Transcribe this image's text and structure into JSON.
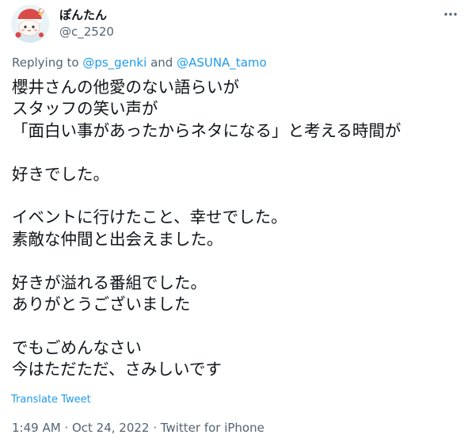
{
  "author": {
    "display_name": "ぽんたん",
    "handle": "@c_2520",
    "avatar": "avatar-illustration"
  },
  "icons": {
    "more": "more-horizontal-icon"
  },
  "reply": {
    "prefix": "Replying to ",
    "mention_1": "@ps_genki",
    "joiner": " and ",
    "mention_2": "@ASUNA_tamo"
  },
  "tweet": {
    "lines": [
      "櫻井さんの他愛のない語らいが",
      "スタッフの笑い声が",
      "「面白い事があったからネタになる」と考える時間が",
      "",
      "好きでした。",
      "",
      "イベントに行けたこと、幸せでした。",
      "素敵な仲間と出会えました。",
      "",
      "好きが溢れる番組でした。",
      "ありがとうございました",
      "",
      "でもごめんなさい",
      "今はただただ、さみしいです"
    ],
    "translate_label": "Translate Tweet"
  },
  "meta": {
    "time": "1:49 AM",
    "date": "Oct 24, 2022",
    "source": "Twitter for iPhone",
    "separator": " · "
  },
  "colors": {
    "text": "#0f1419",
    "secondary": "#536471",
    "link": "#1d9bf0"
  }
}
